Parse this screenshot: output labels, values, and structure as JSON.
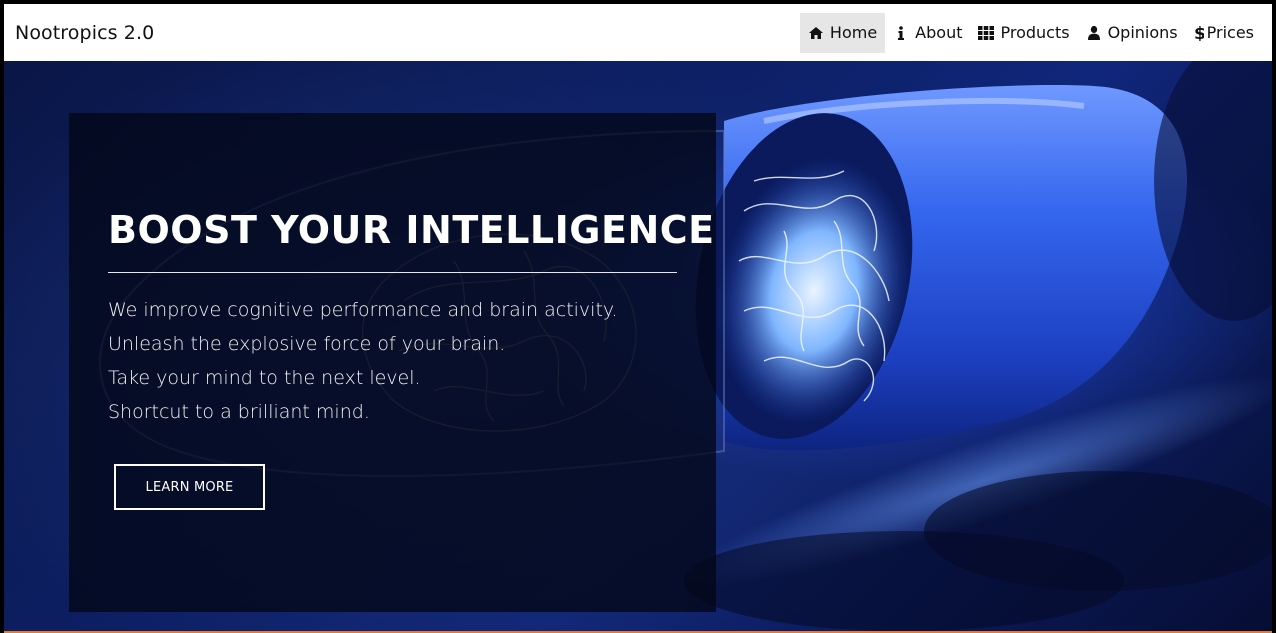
{
  "brand": "Nootropics 2.0",
  "nav": {
    "items": [
      {
        "label": "Home",
        "icon": "home-icon",
        "active": true
      },
      {
        "label": "About",
        "icon": "info-icon",
        "active": false
      },
      {
        "label": "Products",
        "icon": "grid-icon",
        "active": false
      },
      {
        "label": "Opinions",
        "icon": "user-icon",
        "active": false
      },
      {
        "label": "Prices",
        "icon": "dollar-icon",
        "active": false
      }
    ]
  },
  "hero": {
    "headline": "BOOST YOUR INTELLIGENCE",
    "lines": [
      "We improve cognitive performance and brain activity.",
      "Unleash the explosive force of your brain.",
      "Take your mind to the next level.",
      "Shortcut to a brilliant mind."
    ],
    "cta_label": "LEARN MORE"
  },
  "colors": {
    "nav_active_bg": "#e6e6e6",
    "capsule_blue": "#2f5fe0",
    "panel_bg": "#020616"
  }
}
